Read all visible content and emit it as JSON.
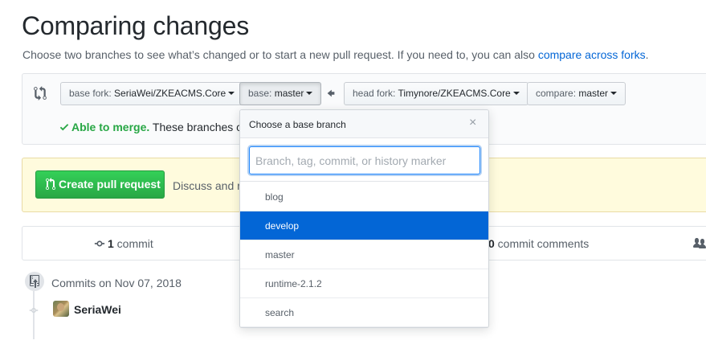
{
  "page": {
    "title": "Comparing changes",
    "subtitle": "Choose two branches to see what’s changed or to start a new pull request. If you need to, you can also ",
    "compare_forks_link": "compare across forks",
    "subtitle_end": "."
  },
  "range": {
    "base_fork_label": "base fork: ",
    "base_fork_value": "SeriaWei/ZKEACMS.Core",
    "base_label": "base: ",
    "base_value": "master",
    "head_fork_label": "head fork: ",
    "head_fork_value": "Timynore/ZKEACMS.Core",
    "compare_label": "compare: ",
    "compare_value": "master",
    "merge_ok": "Able to merge.",
    "merge_rest": " These branches ca"
  },
  "cta": {
    "create_label": "Create pull request",
    "discuss_text": "Discuss and re"
  },
  "stats": {
    "commits_count": "1",
    "commits_label": " commit",
    "comments_count": "0",
    "comments_label": " commit comments"
  },
  "timeline": {
    "date_label": "Commits on Nov 07, 2018",
    "author": "SeriaWei"
  },
  "dropdown": {
    "title": "Choose a base branch",
    "close": "×",
    "filter_placeholder": "Branch, tag, commit, or history marker",
    "filter_value": "",
    "items": [
      {
        "label": "blog",
        "selected": false
      },
      {
        "label": "develop",
        "selected": true
      },
      {
        "label": "master",
        "selected": false
      },
      {
        "label": "runtime-2.1.2",
        "selected": false
      },
      {
        "label": "search",
        "selected": false
      }
    ]
  },
  "colors": {
    "accent": "#0366d6",
    "success": "#28a745",
    "cta_bg": "#fffbdd"
  },
  "icons": [
    "git-compare-icon",
    "arrow-left-icon",
    "check-icon",
    "git-pull-request-icon",
    "git-commit-icon",
    "people-icon",
    "repo-push-icon",
    "close-icon"
  ]
}
